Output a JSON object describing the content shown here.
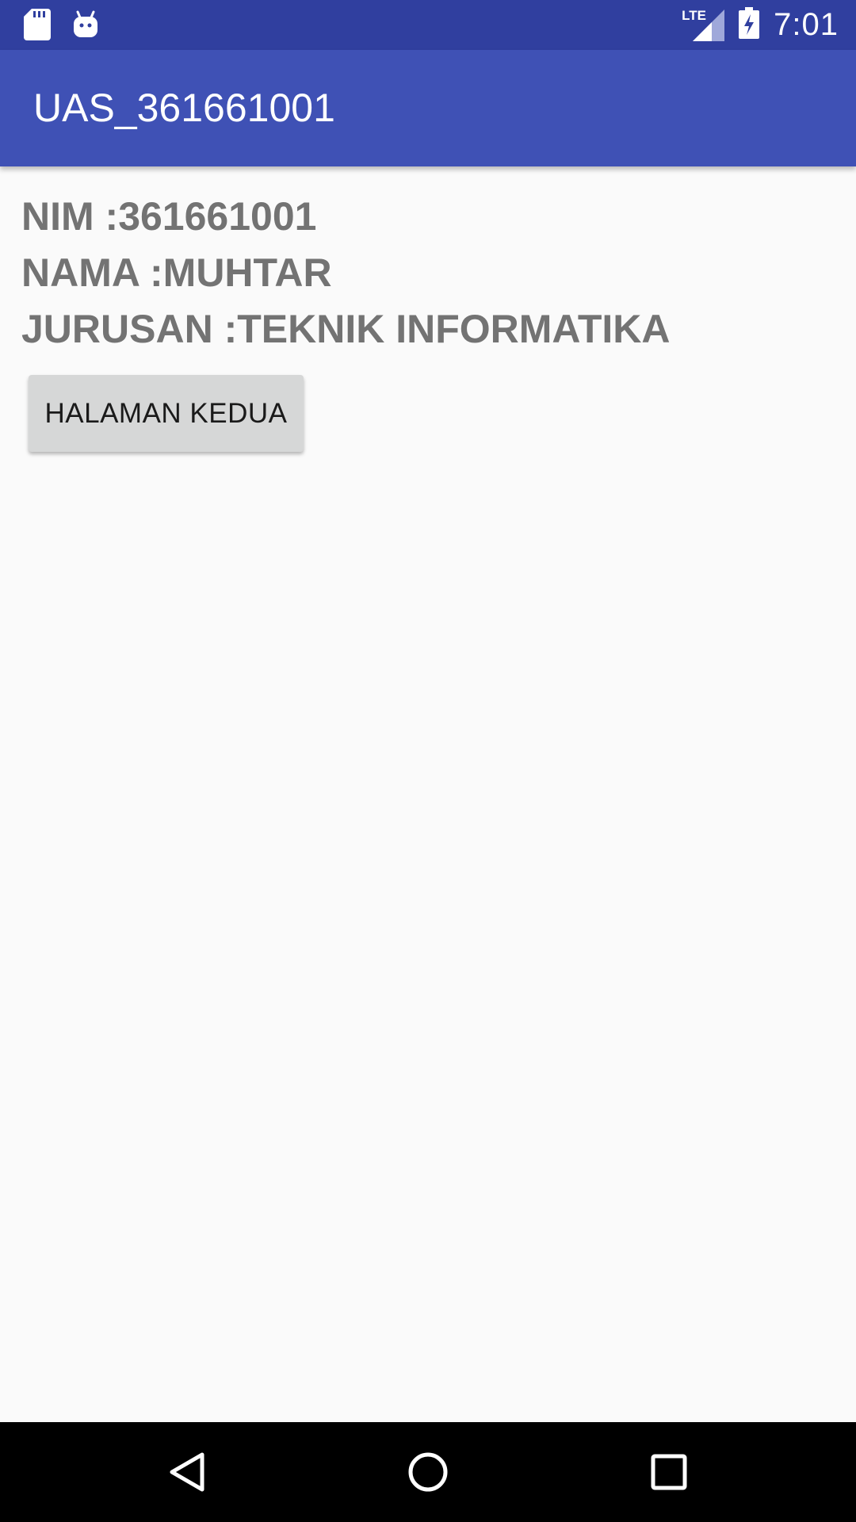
{
  "status_bar": {
    "network": "LTE",
    "time": "7:01",
    "icons": [
      "sd-card-icon",
      "android-icon",
      "signal-icon",
      "battery-charging-icon"
    ]
  },
  "app_bar": {
    "title": "UAS_361661001"
  },
  "content": {
    "nim_line": "NIM :361661001",
    "nama_line": "NAMA :MUHTAR",
    "jurusan_line": "JURUSAN :TEKNIK INFORMATIKA",
    "button_label": "HALAMAN KEDUA"
  },
  "nav_bar": {
    "icons": [
      "back-icon",
      "home-icon",
      "recents-icon"
    ]
  },
  "colors": {
    "status_bar": "#303f9f",
    "app_bar": "#3f51b5",
    "background": "#fafafa",
    "text_secondary": "#737373",
    "button": "#d6d7d7"
  }
}
